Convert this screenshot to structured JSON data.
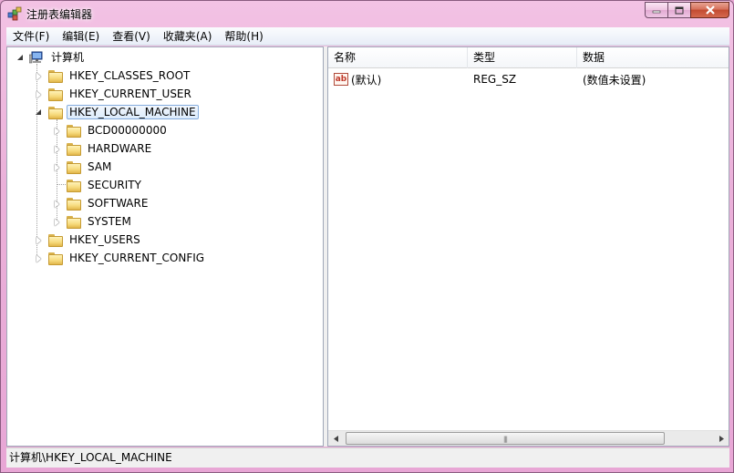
{
  "window": {
    "title": "注册表编辑器",
    "accent_color": "#e8a6d5"
  },
  "menu": {
    "items": [
      {
        "label": "文件(F)"
      },
      {
        "label": "编辑(E)"
      },
      {
        "label": "查看(V)"
      },
      {
        "label": "收藏夹(A)"
      },
      {
        "label": "帮助(H)"
      }
    ]
  },
  "tree": {
    "root": {
      "label": "计算机",
      "icon": "computer-icon"
    },
    "hives": [
      {
        "label": "HKEY_CLASSES_ROOT",
        "state": "collapsed"
      },
      {
        "label": "HKEY_CURRENT_USER",
        "state": "collapsed"
      },
      {
        "label": "HKEY_LOCAL_MACHINE",
        "state": "expanded",
        "selected": true
      },
      {
        "label": "HKEY_USERS",
        "state": "collapsed"
      },
      {
        "label": "HKEY_CURRENT_CONFIG",
        "state": "collapsed"
      }
    ],
    "hklm_children": [
      {
        "label": "BCD00000000",
        "state": "collapsed"
      },
      {
        "label": "HARDWARE",
        "state": "collapsed"
      },
      {
        "label": "SAM",
        "state": "collapsed"
      },
      {
        "label": "SECURITY",
        "state": "leaf"
      },
      {
        "label": "SOFTWARE",
        "state": "collapsed"
      },
      {
        "label": "SYSTEM",
        "state": "collapsed"
      }
    ]
  },
  "list": {
    "columns": [
      "名称",
      "类型",
      "数据"
    ],
    "rows": [
      {
        "name": "(默认)",
        "type": "REG_SZ",
        "data": "(数值未设置)",
        "icon": "string-value-icon"
      }
    ]
  },
  "status": {
    "path": "计算机\\HKEY_LOCAL_MACHINE"
  }
}
